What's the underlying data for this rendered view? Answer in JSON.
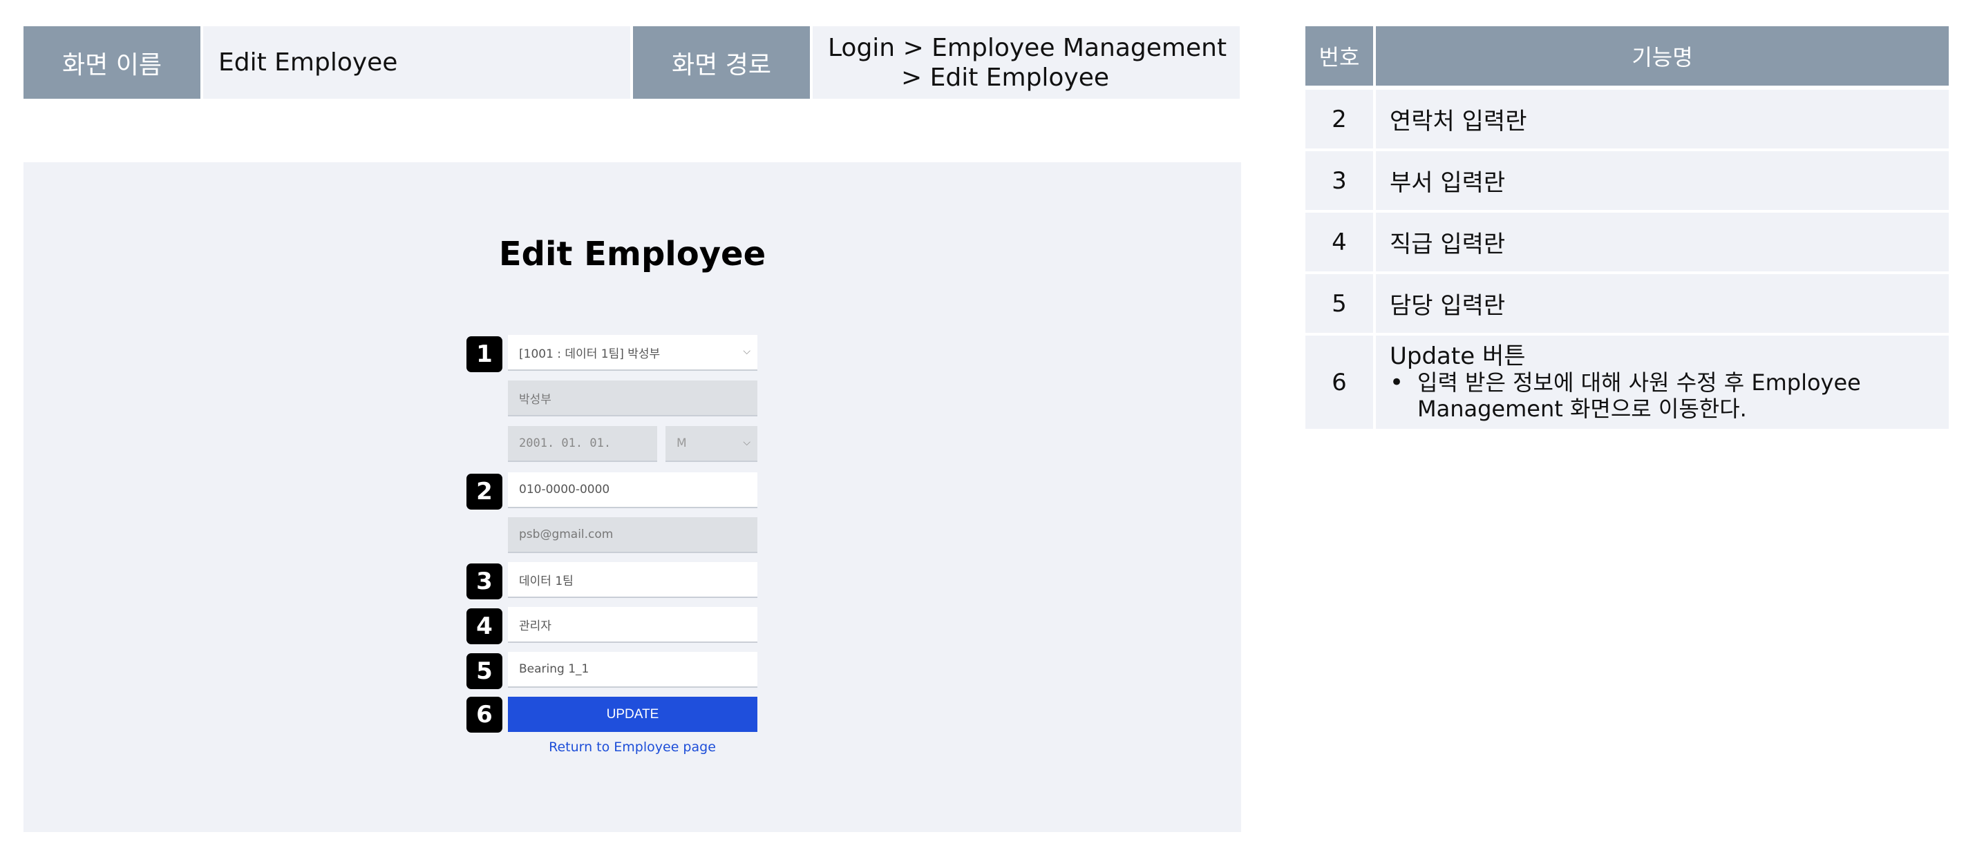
{
  "header": {
    "screen_name_label": "화면 이름",
    "screen_name": "Edit Employee",
    "screen_path_label": "화면 경로",
    "screen_path_line1": "Login > Employee Management",
    "screen_path_line2": "> Edit Employee"
  },
  "mockup": {
    "title": "Edit Employee",
    "badges": [
      "1",
      "2",
      "3",
      "4",
      "5",
      "6"
    ],
    "employee_select": "[1001 : 데이터 1팀] 박성부",
    "name": "박성부",
    "birth": "2001. 01. 01.",
    "gender": "M",
    "phone": "010-0000-0000",
    "email": "psb@gmail.com",
    "department": "데이터 1팀",
    "position": "관리자",
    "assignment": "Bearing 1_1",
    "update_label": "UPDATE",
    "return_label": "Return to Employee page"
  },
  "function_table": {
    "col_number": "번호",
    "col_function": "기능명",
    "rows": [
      {
        "no": "2",
        "name": "연락처 입력란"
      },
      {
        "no": "3",
        "name": "부서 입력란"
      },
      {
        "no": "4",
        "name": "직급 입력란"
      },
      {
        "no": "5",
        "name": "담당 입력란"
      },
      {
        "no": "6",
        "name": "Update 버튼",
        "bullet": "입력 받은 정보에 대해 사원 수정 후 Employee Management 화면으로 이동한다."
      }
    ],
    "bullet_symbol": "•"
  },
  "colors": {
    "header_gray": "#8a9aaa",
    "panel_bg": "#f0f2f7",
    "update_blue": "#1f4fdc"
  }
}
